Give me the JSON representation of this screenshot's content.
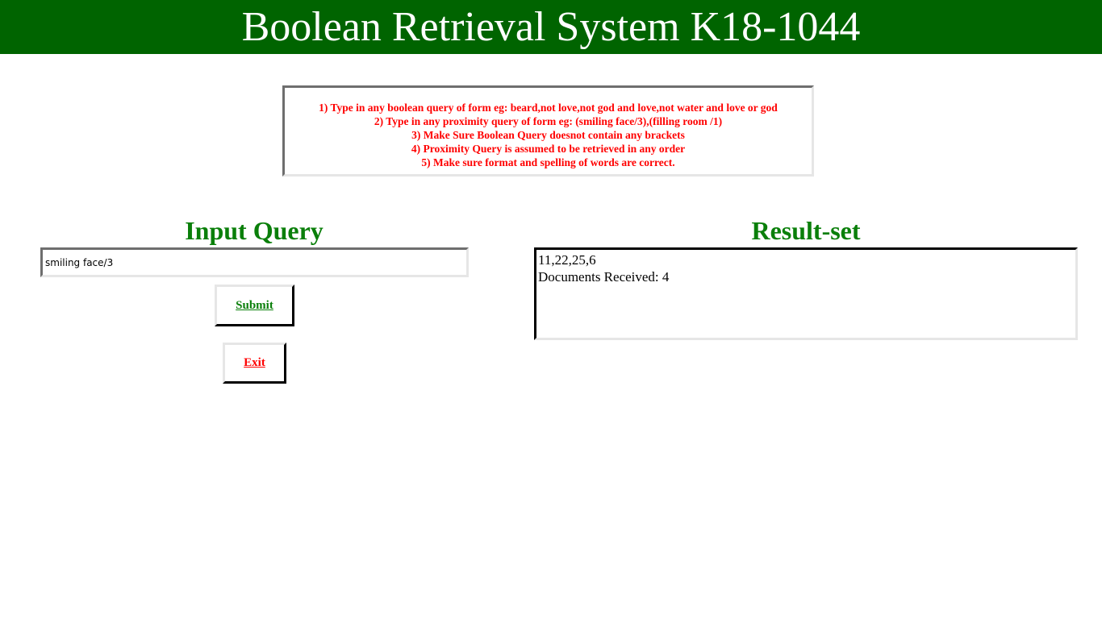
{
  "header": {
    "title": "Boolean Retrieval System K18-1044",
    "background_color": "#006400"
  },
  "instructions": {
    "lines": [
      "1) Type in any boolean query of form eg: beard,not love,not god and love,not water and love or god",
      "2) Type in any proximity query of form eg: (smiling face/3),(filling room /1)",
      "3) Make Sure Boolean Query doesnot contain any brackets",
      "4) Proximity Query is assumed to be retrieved in any order",
      "5) Make sure format and spelling of words are correct."
    ],
    "text_color": "#ff0000"
  },
  "input_panel": {
    "heading": "Input Query",
    "query_value": "smiling face/3",
    "submit_label": "Submit",
    "exit_label": "Exit"
  },
  "result_panel": {
    "heading": "Result-set",
    "result_lines": [
      "11,22,25,6",
      "Documents Received: 4"
    ]
  }
}
